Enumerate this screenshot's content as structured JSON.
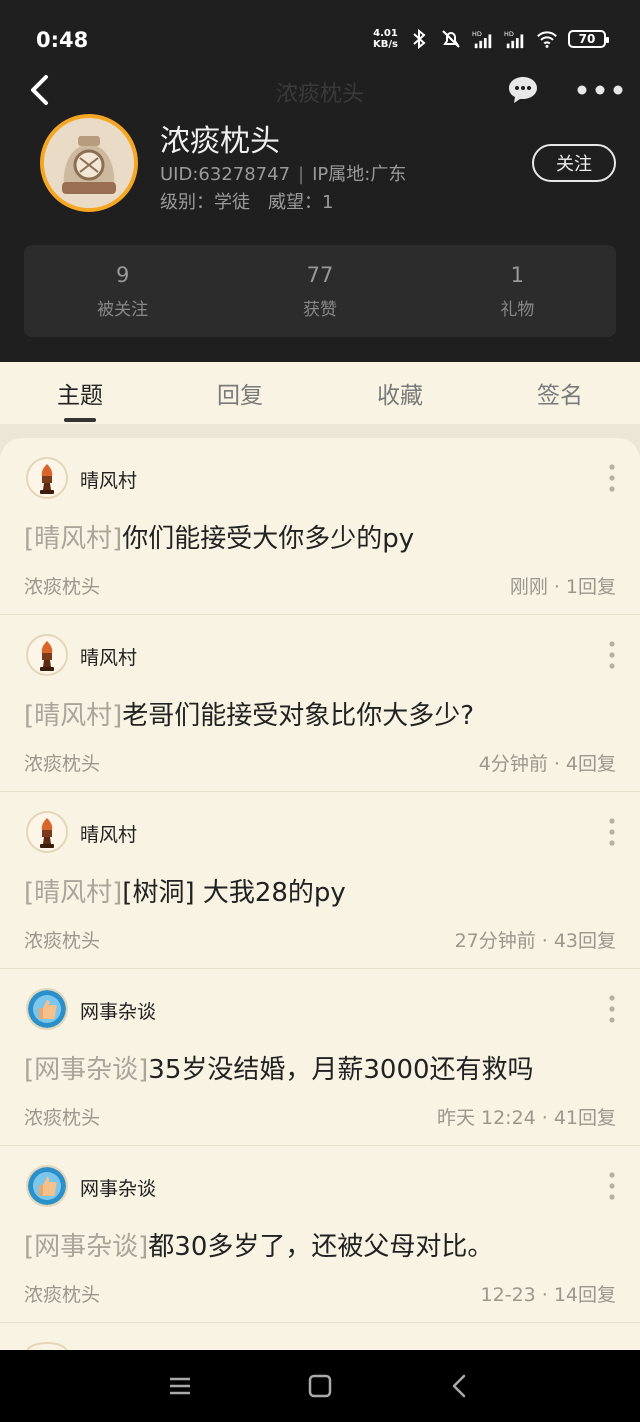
{
  "status_bar": {
    "time": "0:48",
    "net_speed_value": "4.01",
    "net_speed_unit": "KB/s",
    "battery": "70"
  },
  "nav": {
    "title": "浓痰枕头"
  },
  "profile": {
    "name": "浓痰枕头",
    "uid": "UID:63278747",
    "ip": "IP属地:广东",
    "level": "级别：学徒",
    "prestige": "威望：1",
    "follow_label": "关注"
  },
  "stats": [
    {
      "value": "9",
      "label": "被关注"
    },
    {
      "value": "77",
      "label": "获赞"
    },
    {
      "value": "1",
      "label": "礼物"
    }
  ],
  "tabs": [
    "主题",
    "回复",
    "收藏",
    "签名"
  ],
  "posts": [
    {
      "forum": "晴风村",
      "tag": "[晴风村]",
      "title": "你们能接受大你多少的py",
      "author": "浓痰枕头",
      "time": "刚刚",
      "replies": "1回复"
    },
    {
      "forum": "晴风村",
      "tag": "[晴风村]",
      "title": "老哥们能接受对象比你大多少?",
      "author": "浓痰枕头",
      "time": "4分钟前",
      "replies": "4回复"
    },
    {
      "forum": "晴风村",
      "tag": "[晴风村]",
      "title": "[树洞] 大我28的py",
      "author": "浓痰枕头",
      "time": "27分钟前",
      "replies": "43回复"
    },
    {
      "forum": "网事杂谈",
      "tag": "[网事杂谈]",
      "title": "35岁没结婚，月薪3000还有救吗",
      "author": "浓痰枕头",
      "time": "昨天  12:24",
      "replies": "41回复"
    },
    {
      "forum": "网事杂谈",
      "tag": "[网事杂谈]",
      "title": "都30多岁了，还被父母对比。",
      "author": "浓痰枕头",
      "time": "12-23",
      "replies": "14回复"
    }
  ],
  "colors": {
    "header_bg": "#1f1f1f",
    "content_bg": "#f8f3e2",
    "avatar_ring": "#f5a623"
  }
}
